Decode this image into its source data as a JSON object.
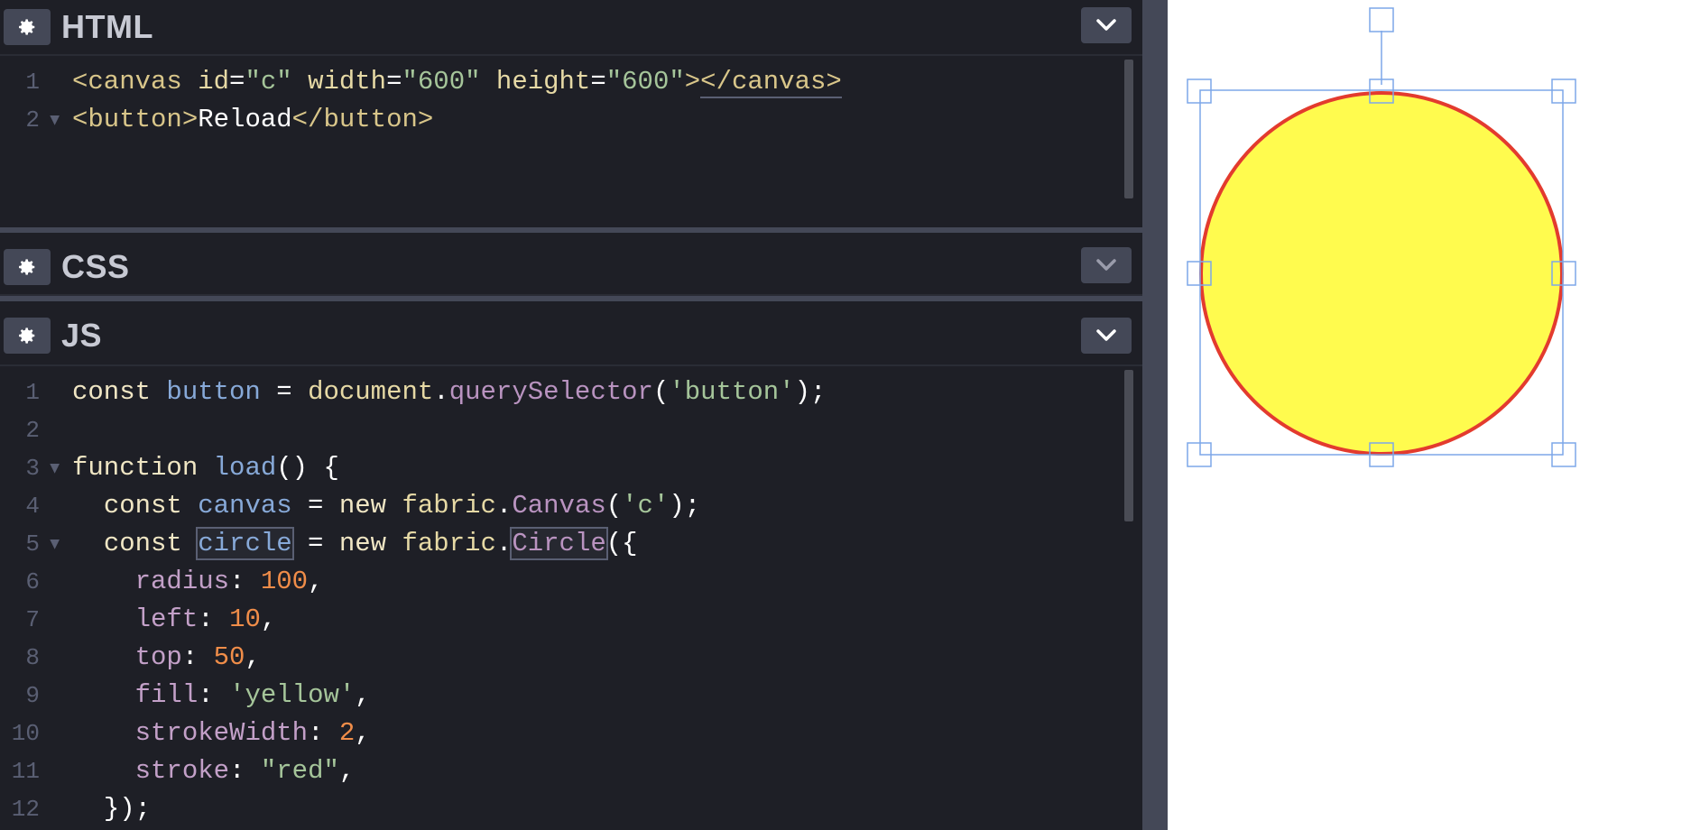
{
  "panels": {
    "html": {
      "title": "HTML"
    },
    "css": {
      "title": "CSS"
    },
    "js": {
      "title": "JS"
    }
  },
  "html_code": {
    "line_numbers": [
      "1",
      "2"
    ],
    "line1": {
      "open": "<canvas",
      "attr_id": " id",
      "eq1": "=",
      "val_id": "\"c\"",
      "attr_width": " width",
      "eq2": "=",
      "val_width": "\"600\"",
      "attr_height": " height",
      "eq3": "=",
      "val_height": "\"600\"",
      "close_open": ">",
      "close_tag": "</canvas>"
    },
    "line2": {
      "open": "<button>",
      "text": "Reload",
      "close": "</button>"
    }
  },
  "js_code": {
    "line_numbers": [
      "1",
      "2",
      "3",
      "4",
      "5",
      "6",
      "7",
      "8",
      "9",
      "10",
      "11",
      "12"
    ],
    "l1": {
      "kw": "const",
      "var": " button",
      "op": " = ",
      "obj": "document",
      "dot": ".",
      "meth": "querySelector",
      "p1": "(",
      "str": "'button'",
      "p2": ");"
    },
    "l3": {
      "kw": "function",
      "fn": " load",
      "rest": "() {"
    },
    "l4": {
      "indent": "  ",
      "kw": "const",
      "var": " canvas",
      "op": " = ",
      "kw2": "new",
      "obj": " fabric",
      "dot": ".",
      "meth": "Canvas",
      "p1": "(",
      "str": "'c'",
      "p2": ");"
    },
    "l5": {
      "indent": "  ",
      "kw": "const",
      "sp": " ",
      "var": "circle",
      "op": " = ",
      "kw2": "new",
      "obj": " fabric",
      "dot": ".",
      "meth": "Circle",
      "p1": "({"
    },
    "l6": {
      "indent": "    ",
      "prop": "radius",
      "colon": ": ",
      "num": "100",
      "comma": ","
    },
    "l7": {
      "indent": "    ",
      "prop": "left",
      "colon": ": ",
      "num": "10",
      "comma": ","
    },
    "l8": {
      "indent": "    ",
      "prop": "top",
      "colon": ": ",
      "num": "50",
      "comma": ","
    },
    "l9": {
      "indent": "    ",
      "prop": "fill",
      "colon": ": ",
      "str": "'yellow'",
      "comma": ","
    },
    "l10": {
      "indent": "    ",
      "prop": "strokeWidth",
      "colon": ": ",
      "num": "2",
      "comma": ","
    },
    "l11": {
      "indent": "    ",
      "prop": "stroke",
      "colon": ": ",
      "str": "\"red\"",
      "comma": ","
    },
    "l12": {
      "indent": "  ",
      "rest": "});"
    }
  },
  "icons": {
    "panel_settings": "gear-icon",
    "panel_collapse": "chevron-down-icon"
  },
  "preview": {
    "circle_fill": "#fffb4e",
    "circle_stroke": "#e33b2e",
    "selection_color": "#7da7e8"
  }
}
